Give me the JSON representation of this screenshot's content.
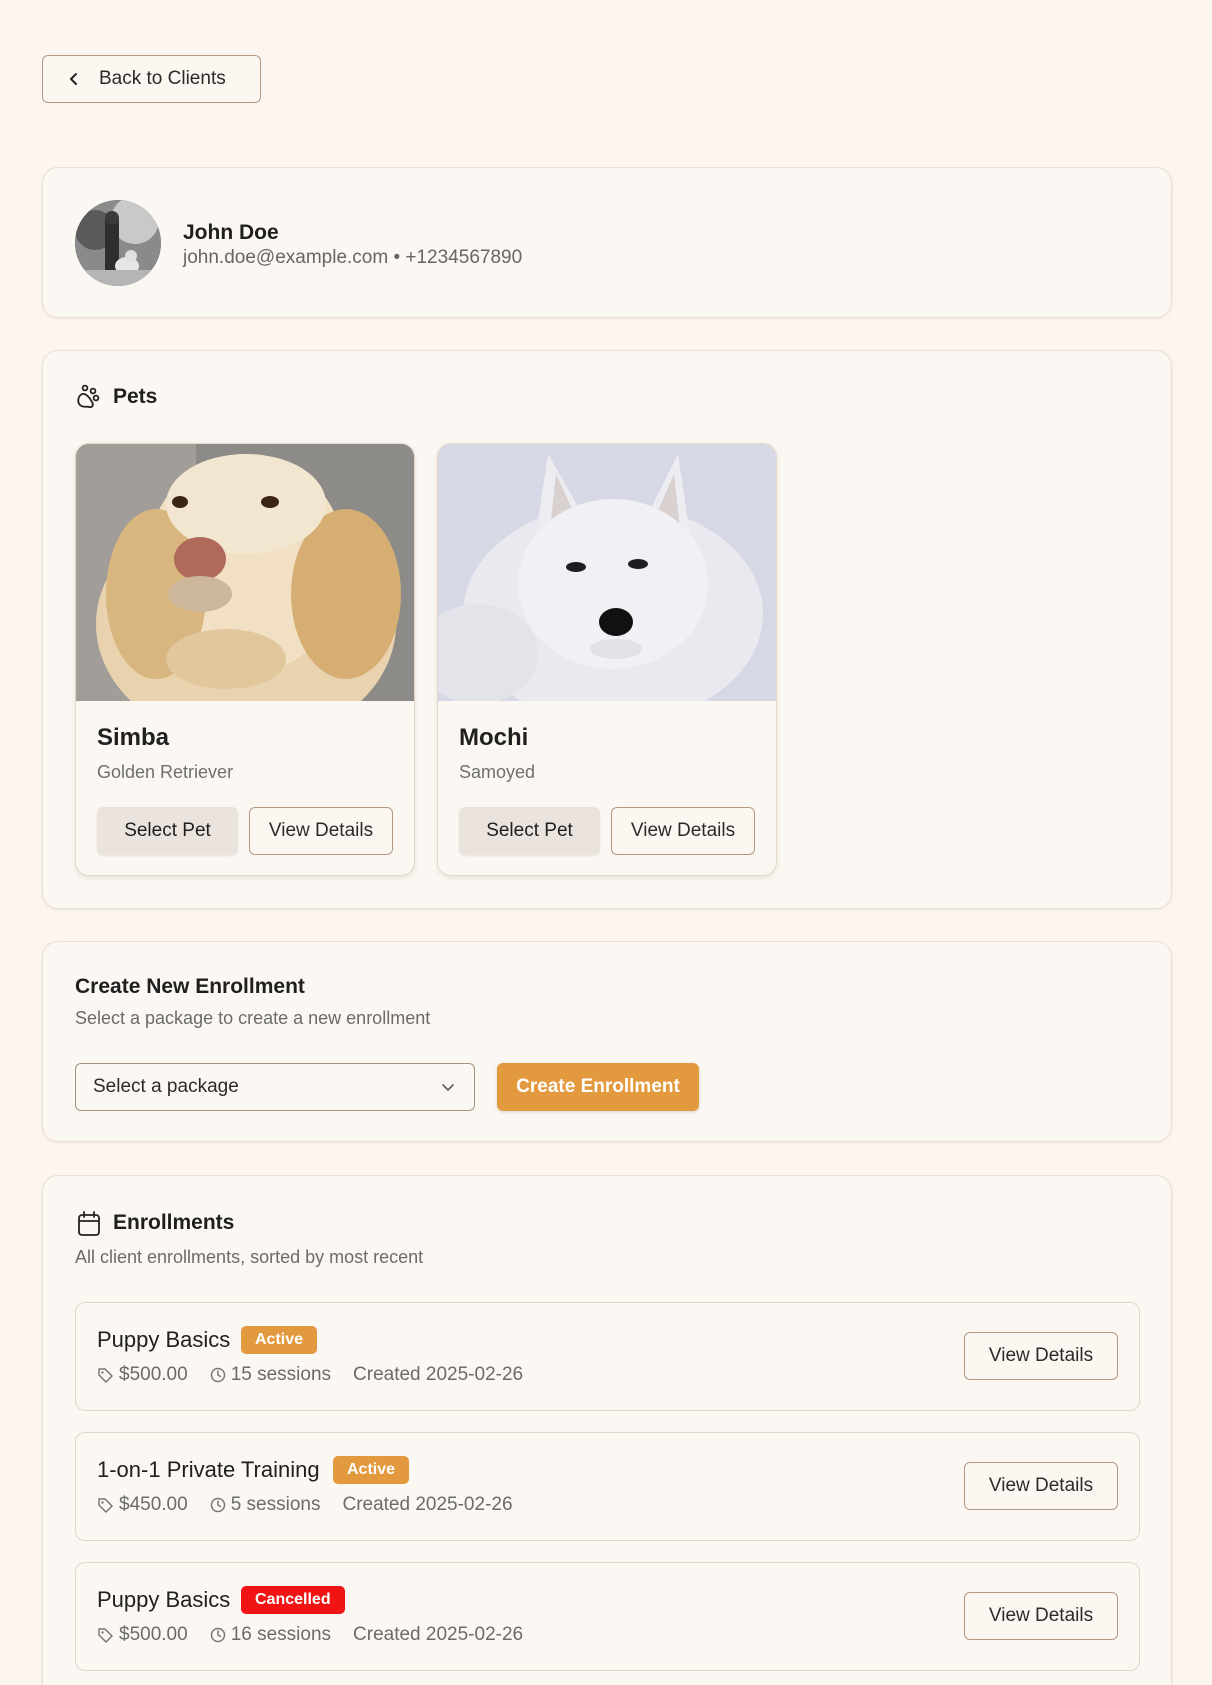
{
  "nav": {
    "back_label": "Back to Clients"
  },
  "client": {
    "name": "John Doe",
    "contact": "john.doe@example.com • +1234567890"
  },
  "pets_section": {
    "title": "Pets",
    "pets": [
      {
        "name": "Simba",
        "breed": "Golden Retriever",
        "select_label": "Select Pet",
        "details_label": "View Details"
      },
      {
        "name": "Mochi",
        "breed": "Samoyed",
        "select_label": "Select Pet",
        "details_label": "View Details"
      }
    ]
  },
  "create_enrollment": {
    "title": "Create New Enrollment",
    "subtitle": "Select a package to create a new enrollment",
    "select_value": "Select a package",
    "button_label": "Create Enrollment"
  },
  "enrollments": {
    "title": "Enrollments",
    "subtitle": "All client enrollments, sorted by most recent",
    "items": [
      {
        "name": "Puppy Basics",
        "status": "Active",
        "price": "$500.00",
        "sessions": "15 sessions",
        "created": "Created 2025-02-26",
        "details_label": "View Details"
      },
      {
        "name": "1-on-1 Private Training",
        "status": "Active",
        "price": "$450.00",
        "sessions": "5 sessions",
        "created": "Created 2025-02-26",
        "details_label": "View Details"
      },
      {
        "name": "Puppy Basics",
        "status": "Cancelled",
        "price": "$500.00",
        "sessions": "16 sessions",
        "created": "Created 2025-02-26",
        "details_label": "View Details"
      }
    ]
  },
  "colors": {
    "accent": "#e3993d",
    "status_active": "#e3993d",
    "status_cancelled": "#f01414",
    "background": "#fdf6f0"
  },
  "icons": [
    "chevron-left-icon",
    "paw-icon",
    "chevron-down-icon",
    "calendar-icon",
    "tag-icon",
    "clock-icon"
  ]
}
